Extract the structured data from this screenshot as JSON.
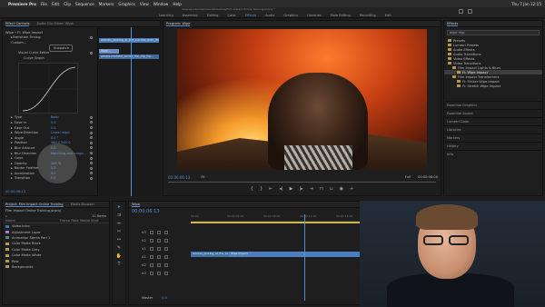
{
  "menubar": {
    "app_name": "Premiere Pro",
    "items": [
      "File",
      "Edit",
      "Clip",
      "Sequence",
      "Markers",
      "Graphics",
      "View",
      "Window",
      "Help"
    ],
    "clock": "Thu 7 Jan 12:15"
  },
  "window_title": "/Users/jordanhammond/Desktop/Film Impact Online Training.prproj *",
  "workspaces": [
    "Learning",
    "Assembly",
    "Editing",
    "Color",
    "Effects",
    "Audio",
    "Graphics",
    "Libraries",
    "Fade Editing",
    "Recording",
    "Edit"
  ],
  "active_workspace": "Effects",
  "effect_controls": {
    "tabs": [
      "Effect Controls",
      "Audio Clip Mixer: Wipe"
    ],
    "master": "Wipe * FI: Wipe Impact",
    "effect_name": "Transition Timing",
    "custom_label": "Custom...",
    "subpatch_label": "Subpatch",
    "curve_label": "Visual Curve Editor",
    "curve_graph": "Curve Graph",
    "rows": [
      {
        "label": "Type",
        "value": "Basic"
      },
      {
        "label": "Ease In",
        "value": "0.0"
      },
      {
        "label": "Ease Out",
        "value": "0.0"
      },
      {
        "label": "Wipe Direction",
        "value": "Linear wipe"
      },
      {
        "label": "Angle",
        "value": "0.0 °"
      },
      {
        "label": "Position",
        "value": "960.0  540.0"
      },
      {
        "label": "Blur Amount",
        "value": "0.0"
      },
      {
        "label": "Blur Direction",
        "value": "Matching and outgo..."
      },
      {
        "label": "Color",
        "value": ""
      },
      {
        "label": "Opacity",
        "value": "100 %"
      },
      {
        "label": "Border Feather",
        "value": "0.0"
      },
      {
        "label": "Acceleration",
        "value": "0.0"
      },
      {
        "label": "Transition",
        "value": "0.0"
      }
    ],
    "clip_bars": [
      "woman_looking_at_the_sunrise_over_the_hi",
      "Wipe...",
      "pexels-michael_lorner_the_clip_fro..."
    ],
    "timecode": "00:00:06:13"
  },
  "program": {
    "title": "Program: Wipe",
    "timecode_left": "00:00:06:13",
    "fit": "Fit",
    "fraction": "Full",
    "timecode_right": "00:00:08:00",
    "controls": [
      "mark-in",
      "mark-out",
      "go-to-in",
      "step-back",
      "play",
      "step-forward",
      "go-to-out",
      "insert",
      "overwrite",
      "export-frame",
      "settings"
    ]
  },
  "effects_panel": {
    "title": "Effects",
    "search_value": "wipe imp",
    "tree": [
      {
        "label": "Presets",
        "indent": 0
      },
      {
        "label": "Lumetri Presets",
        "indent": 0
      },
      {
        "label": "Audio Effects",
        "indent": 0
      },
      {
        "label": "Audio Transitions",
        "indent": 0
      },
      {
        "label": "Video Effects",
        "indent": 0
      },
      {
        "label": "Video Transitions",
        "indent": 0
      },
      {
        "label": "Film Impact Lights & Blurs",
        "indent": 1
      },
      {
        "label": "FI: Wipe Impact",
        "indent": 2,
        "selected": true
      },
      {
        "label": "Film Impact Transformers",
        "indent": 1
      },
      {
        "label": "FI: Flicker Wipe Impact",
        "indent": 2
      },
      {
        "label": "FI: Stretch Wipe Impact",
        "indent": 2
      }
    ],
    "sections": [
      "Essential Graphics",
      "Essential Sound",
      "Lumetri Color",
      "Libraries",
      "Markers",
      "History",
      "Info"
    ]
  },
  "project": {
    "tabs": [
      "Project: Film Impact Online Training",
      "Media Browser"
    ],
    "path": "Film Impact Online Training.prproj",
    "item_count": "11 Items",
    "headers": [
      "Name",
      "Frame Rate",
      "Media Start"
    ],
    "items": [
      {
        "name": "Video Intro",
        "color": "#4e6fb5"
      },
      {
        "name": "Adjustment Layer",
        "color": "#a67bd6"
      },
      {
        "name": "Animation Stems Part 1",
        "color": "#4e8f6e"
      },
      {
        "name": "Color Matte Black",
        "color": "#b2a05a"
      },
      {
        "name": "Color Matte Grey",
        "color": "#b2a05a"
      },
      {
        "name": "Color Matte White",
        "color": "#b2a05a"
      },
      {
        "name": "Raw",
        "color": "#b29a4a"
      },
      {
        "name": "Backgrounds",
        "color": "#b29a4a"
      }
    ]
  },
  "timeline": {
    "title": "Wipe",
    "timecode": "00:00:06:13",
    "ruler": [
      "00:00",
      "00:00:04:00",
      "00:00:08:00",
      "00:00:12:00",
      "00:00:16:00"
    ],
    "tracks": [
      {
        "id": "V3"
      },
      {
        "id": "V2"
      },
      {
        "id": "V1"
      },
      {
        "id": "A1"
      },
      {
        "id": "A2"
      },
      {
        "id": "A3"
      }
    ],
    "clips": [
      "woman_looking_at_the_su...",
      "Wipe Impact"
    ],
    "master": "Master",
    "master_value": "0.0"
  }
}
